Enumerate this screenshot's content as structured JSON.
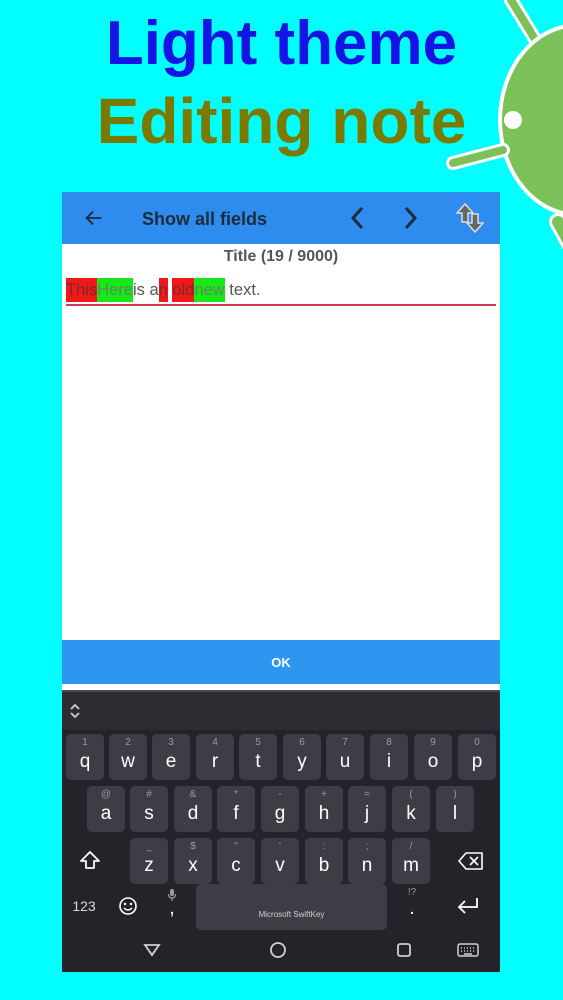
{
  "promo": {
    "line1": "Light theme",
    "line2": "Editing note",
    "colors": {
      "line1": "#1414E6",
      "line2": "#7A7A00",
      "background": "#00FFFF"
    }
  },
  "appbar": {
    "title": "Show all fields",
    "back_icon": "arrow-left-icon",
    "prev_icon": "chevron-left-icon",
    "next_icon": "chevron-right-icon",
    "swap_icon": "swap-vertical-icon"
  },
  "note": {
    "counter": "Title (19 / 9000)",
    "diff": [
      {
        "text": "This",
        "type": "deleted"
      },
      {
        "text": "Here",
        "type": "inserted"
      },
      {
        "text": " is a",
        "type": "same"
      },
      {
        "text": "n",
        "type": "deleted"
      },
      {
        "text": " ",
        "type": "same"
      },
      {
        "text": "old",
        "type": "deleted"
      },
      {
        "text": "new",
        "type": "inserted"
      },
      {
        "text": " text.",
        "type": "same"
      }
    ]
  },
  "ok_label": "OK",
  "keyboard": {
    "brand": "Microsoft SwiftKey",
    "row1": [
      {
        "hint": "1",
        "key": "q"
      },
      {
        "hint": "2",
        "key": "w"
      },
      {
        "hint": "3",
        "key": "e"
      },
      {
        "hint": "4",
        "key": "r"
      },
      {
        "hint": "5",
        "key": "t"
      },
      {
        "hint": "6",
        "key": "y"
      },
      {
        "hint": "7",
        "key": "u"
      },
      {
        "hint": "8",
        "key": "i"
      },
      {
        "hint": "9",
        "key": "o"
      },
      {
        "hint": "0",
        "key": "p"
      }
    ],
    "row2": [
      {
        "hint": "@",
        "key": "a"
      },
      {
        "hint": "#",
        "key": "s"
      },
      {
        "hint": "&",
        "key": "d"
      },
      {
        "hint": "*",
        "key": "f"
      },
      {
        "hint": "-",
        "key": "g"
      },
      {
        "hint": "+",
        "key": "h"
      },
      {
        "hint": "=",
        "key": "j"
      },
      {
        "hint": "(",
        "key": "k"
      },
      {
        "hint": ")",
        "key": "l"
      }
    ],
    "row3": [
      {
        "hint": "_",
        "key": "z"
      },
      {
        "hint": "$",
        "key": "x"
      },
      {
        "hint": "\"",
        "key": "c"
      },
      {
        "hint": "'",
        "key": "v"
      },
      {
        "hint": ":",
        "key": "b"
      },
      {
        "hint": ";",
        "key": "n"
      },
      {
        "hint": "/",
        "key": "m"
      }
    ],
    "numbers_label": "123",
    "comma": {
      "hint": "",
      "key": ","
    },
    "period": {
      "hint": "!?",
      "key": "."
    }
  }
}
